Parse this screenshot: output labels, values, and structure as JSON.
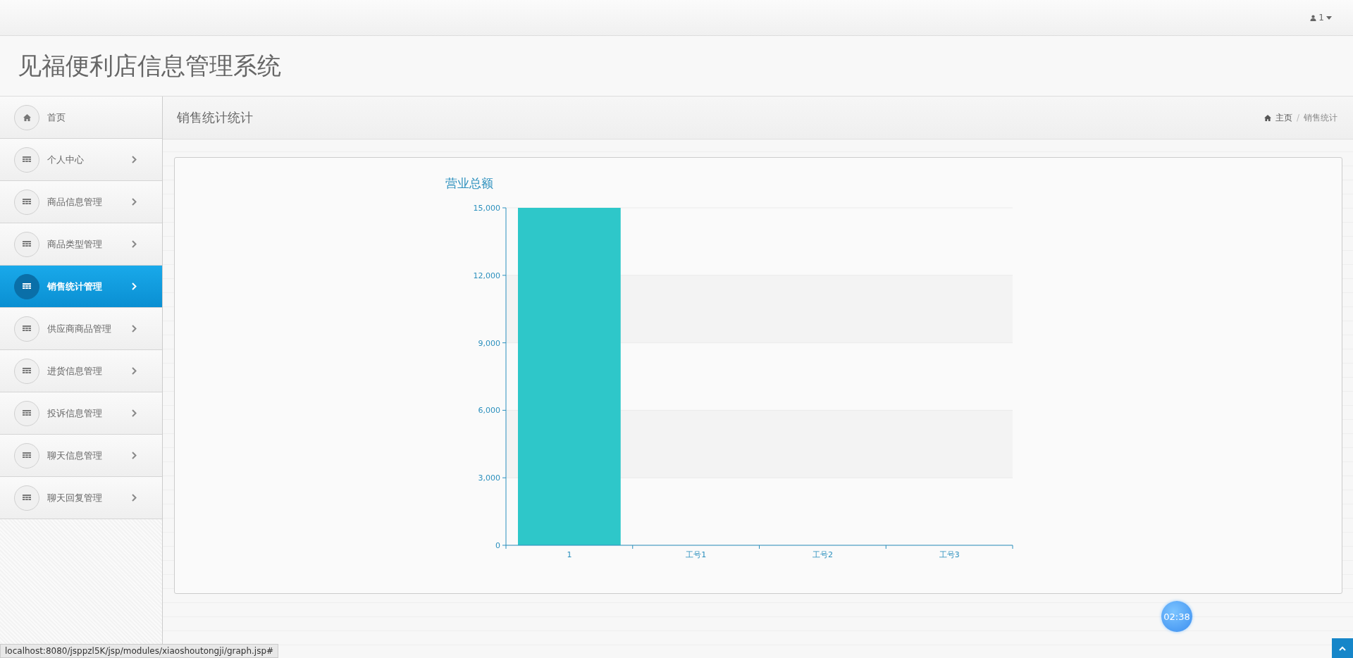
{
  "top_bar": {
    "user_menu": "1"
  },
  "app_title": "见福便利店信息管理系统",
  "sidebar": {
    "items": [
      {
        "label": "首页",
        "kind": "link",
        "selected": false
      },
      {
        "label": "个人中心",
        "kind": "submenu",
        "selected": false
      },
      {
        "label": "商品信息管理",
        "kind": "submenu",
        "selected": false
      },
      {
        "label": "商品类型管理",
        "kind": "submenu",
        "selected": false
      },
      {
        "label": "销售统计管理",
        "kind": "submenu",
        "selected": true
      },
      {
        "label": "供应商商品管理",
        "kind": "submenu",
        "selected": false
      },
      {
        "label": "进货信息管理",
        "kind": "submenu",
        "selected": false
      },
      {
        "label": "投诉信息管理",
        "kind": "submenu",
        "selected": false
      },
      {
        "label": "聊天信息管理",
        "kind": "submenu",
        "selected": false
      },
      {
        "label": "聊天回复管理",
        "kind": "submenu",
        "selected": false
      }
    ]
  },
  "content": {
    "page_title": "销售统计统计",
    "breadcrumb": [
      "主页",
      "销售统计"
    ],
    "breadcrumb_separator": "/",
    "chart_data": {
      "type": "bar",
      "title": "营业总额",
      "categories": [
        "1",
        "工号1",
        "工号2",
        "工号3"
      ],
      "series": [
        {
          "color": "#2ec7c9",
          "values": [
            15000,
            0,
            0,
            0
          ]
        }
      ],
      "grid": true,
      "ylim": [
        0,
        15000
      ],
      "yticks": [
        {
          "value": 0,
          "label": "0"
        },
        {
          "value": 3000,
          "label": "3,000"
        },
        {
          "value": 6000,
          "label": "6,000"
        },
        {
          "value": 9000,
          "label": "9,000"
        },
        {
          "value": 12000,
          "label": "12,000"
        },
        {
          "value": 15000,
          "label": "15,000"
        }
      ]
    }
  },
  "timer": "02:38",
  "status_url": "localhost:8080/jsppzl5K/jsp/modules/xiaoshoutongji/graph.jsp#"
}
